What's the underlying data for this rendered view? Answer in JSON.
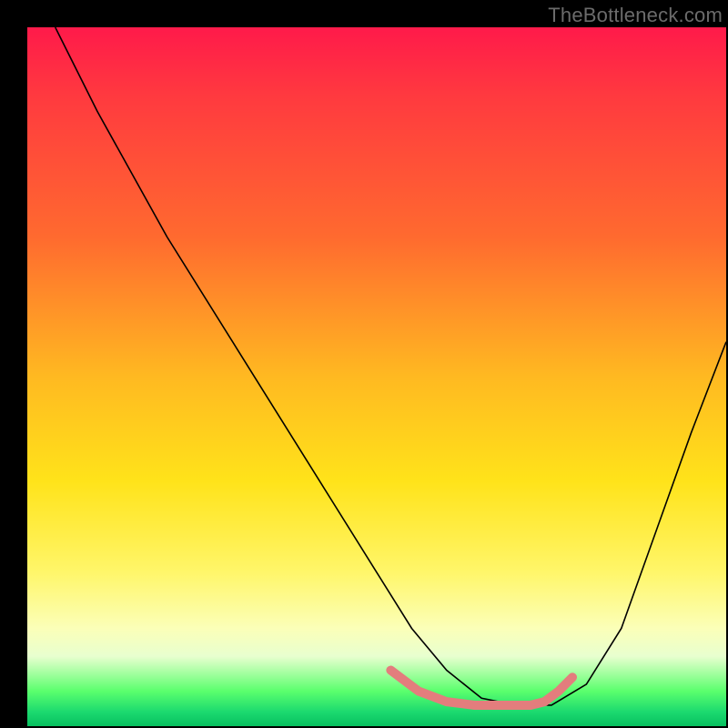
{
  "attribution": "TheBottleneck.com",
  "chart_data": {
    "type": "line",
    "title": "",
    "xlabel": "",
    "ylabel": "",
    "xlim": [
      0,
      100
    ],
    "ylim": [
      0,
      100
    ],
    "series": [
      {
        "name": "black-curve",
        "color": "#000000",
        "width": 1.6,
        "x": [
          4,
          10,
          20,
          30,
          40,
          50,
          55,
          60,
          65,
          70,
          75,
          80,
          85,
          90,
          95,
          100
        ],
        "y": [
          100,
          88,
          70,
          54,
          38,
          22,
          14,
          8,
          4,
          3,
          3,
          6,
          14,
          28,
          42,
          55
        ]
      },
      {
        "name": "pink-highlight",
        "color": "#e37d7d",
        "width": 10,
        "linecap": "round",
        "x": [
          52,
          56,
          60,
          64,
          68,
          72,
          74,
          76,
          78
        ],
        "y": [
          8,
          5,
          3.5,
          3,
          3,
          3,
          3.5,
          5,
          7
        ]
      }
    ],
    "background": {
      "type": "vertical-gradient",
      "stops": [
        {
          "pos": 0.0,
          "color": "#ff1a4a"
        },
        {
          "pos": 0.5,
          "color": "#ffb921"
        },
        {
          "pos": 0.78,
          "color": "#fff66a"
        },
        {
          "pos": 0.95,
          "color": "#5aff6d"
        },
        {
          "pos": 1.0,
          "color": "#08c060"
        }
      ]
    }
  }
}
